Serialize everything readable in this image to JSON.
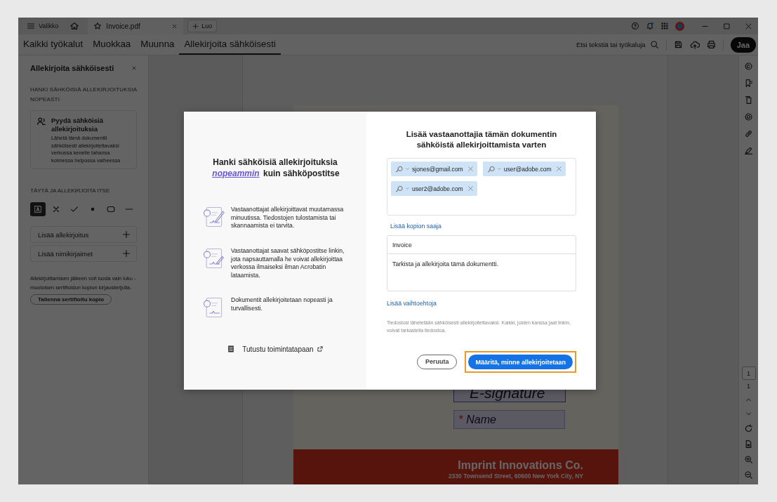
{
  "title_bar": {
    "menu_label": "Valikko",
    "tabs": [
      {
        "label": "Invoice.pdf"
      }
    ],
    "new_button": "Luo"
  },
  "toolbar": {
    "tools": [
      {
        "label": "Kaikki työkalut",
        "selected": false
      },
      {
        "label": "Muokkaa",
        "selected": false
      },
      {
        "label": "Muunna",
        "selected": false
      },
      {
        "label": "Allekirjoita sähköisesti",
        "selected": true
      }
    ],
    "search_label": "Etsi tekstiä tai työkaluja",
    "share_button": "Jaa"
  },
  "side_panel": {
    "title": "Allekirjoita sähköisesti",
    "request_section": "HANKI SÄHKÖISIÄ ALLEKIRJOITUKSIA NOPEASTI",
    "request_card": {
      "title": "Pyydä sähköisiä allekirjoituksia",
      "text": "Lähetä tämä dokumentti sähköisesti allekirjoitettavaksi verkossa kenelle tahansa kolmessa helpossa vaiheessa"
    },
    "fill_section": "TÄYTÄ JA ALLEKIRJOITA ITSE",
    "fill_tools": [
      {
        "kind": "text",
        "selected": true
      },
      {
        "kind": "cross",
        "selected": false
      },
      {
        "kind": "check",
        "selected": false
      },
      {
        "kind": "dot",
        "selected": false
      },
      {
        "kind": "rect",
        "selected": false
      },
      {
        "kind": "line",
        "selected": false
      }
    ],
    "add_rows": [
      "Lisää allekirjoitus",
      "Lisää nimikirjaimet"
    ],
    "note": "Allekirjoittamisen jälkeen voit luoda vain luku -muotoisen sertifioidun kopion kirjausketjulla.",
    "save_button": "Tallenna sertifioitu kopio"
  },
  "document": {
    "signature_field": "E-signature",
    "name_field": {
      "required_mark": "*",
      "label": "Name"
    },
    "company": "Imprint Innovations Co.",
    "address": "2330 Townsend Street, 60600 New York City, NY"
  },
  "page_nav": {
    "current": "1",
    "total": "1"
  },
  "dialog": {
    "heading": "Hanki sähköisiä allekirjoituksia *nopeammin* kuin sähköpostitse",
    "features": [
      "Vastaanottajat allekirjoittavat muutamassa minuutissa. Tiedostojen tulostamista tai skannaamista ei tarvita.",
      "Vastaanottajat saavat sähköpostitse linkin, jota napsauttamalla he voivat allekirjoittaa verkossa ilmaiseksi ilman Acrobatin lataamista.",
      "Dokumentit allekirjoitetaan nopeasti ja turvallisesti."
    ],
    "learn_link": "Tutustu toimintatapaan",
    "title": "Lisää vastaanottajia tämän dokumentin sähköistä allekirjoittamista varten",
    "recipients": [
      "sjones@gmail.com",
      "user@adobe.com",
      "user2@adobe.com"
    ],
    "add_cc_link": "Lisää kopion saaja",
    "subject": "Invoice",
    "message": "Tarkista ja allekirjoita tämä dokumentti.",
    "more_options_link": "Lisää vaihtoehtoja",
    "note": "Tiedostosi lähetetään sähköisesti allekirjoitettavaksi. Kaikki, joiden kanssa jaat linkin, voivat tarkastella tiedostoa.",
    "cancel_button": "Peruuta",
    "primary_button": "Määritä, minne allekirjoitetaan",
    "primary_highlighted": true
  }
}
